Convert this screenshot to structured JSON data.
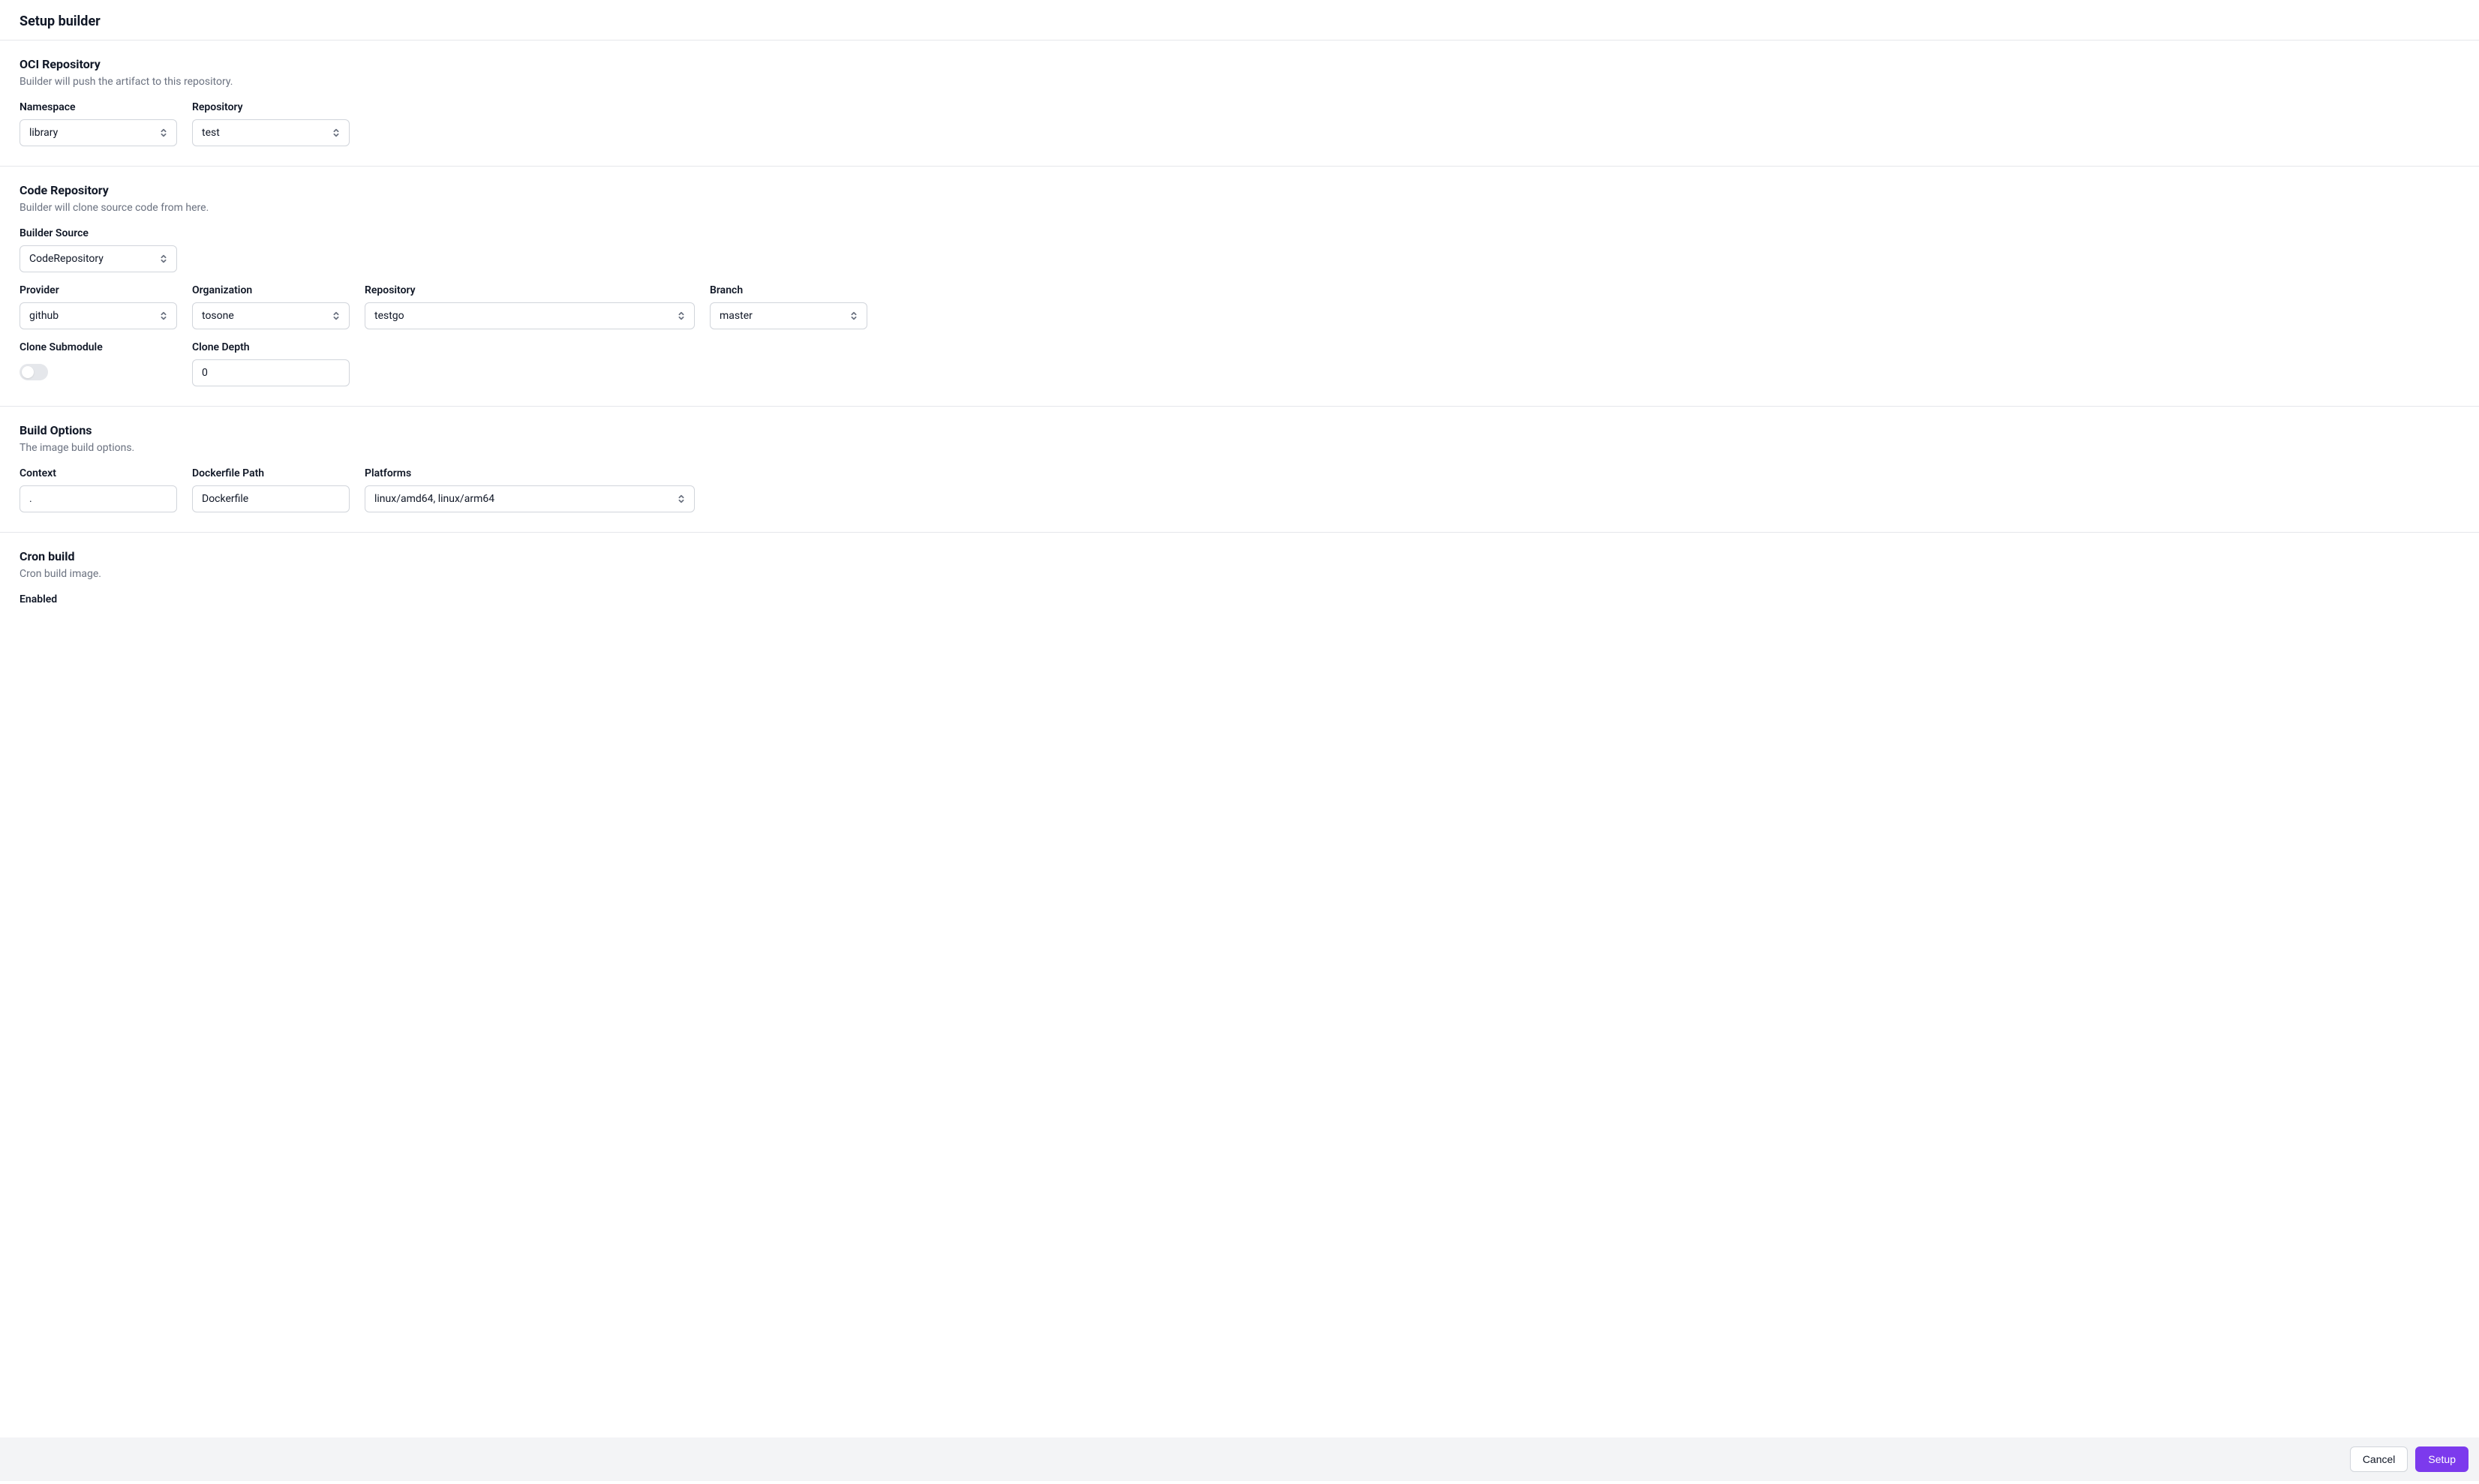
{
  "page_title": "Setup builder",
  "oci": {
    "title": "OCI Repository",
    "desc": "Builder will push the artifact to this repository.",
    "namespace_label": "Namespace",
    "namespace_value": "library",
    "repository_label": "Repository",
    "repository_value": "test"
  },
  "code": {
    "title": "Code Repository",
    "desc": "Builder will clone source code from here.",
    "builder_source_label": "Builder Source",
    "builder_source_value": "CodeRepository",
    "provider_label": "Provider",
    "provider_value": "github",
    "organization_label": "Organization",
    "organization_value": "tosone",
    "repository_label": "Repository",
    "repository_value": "testgo",
    "branch_label": "Branch",
    "branch_value": "master",
    "clone_submodule_label": "Clone Submodule",
    "clone_depth_label": "Clone Depth",
    "clone_depth_value": "0"
  },
  "build": {
    "title": "Build Options",
    "desc": "The image build options.",
    "context_label": "Context",
    "context_value": ".",
    "dockerfile_label": "Dockerfile Path",
    "dockerfile_value": "Dockerfile",
    "platforms_label": "Platforms",
    "platforms_value": "linux/amd64, linux/arm64"
  },
  "cron": {
    "title": "Cron build",
    "desc": "Cron build image.",
    "enabled_label": "Enabled"
  },
  "footer": {
    "cancel": "Cancel",
    "setup": "Setup"
  }
}
